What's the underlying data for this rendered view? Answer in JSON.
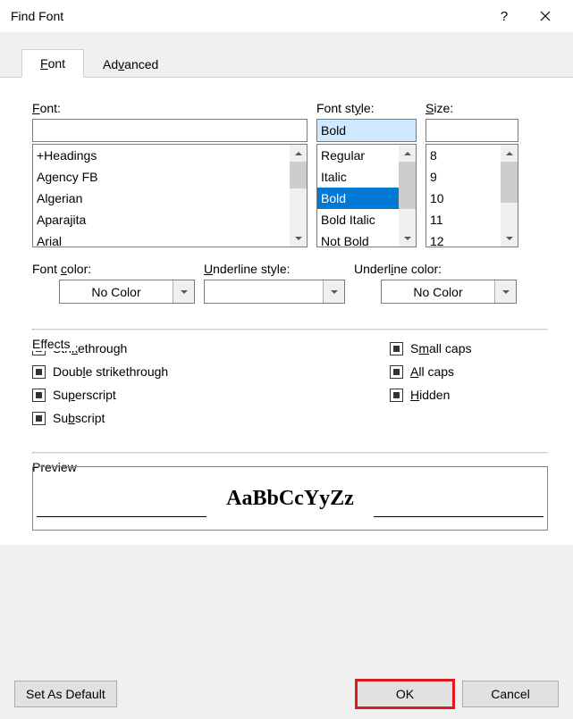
{
  "title": "Find Font",
  "tabs": {
    "font": "Font",
    "advanced": "Advanced"
  },
  "labels": {
    "font": "Font:",
    "fontStyle": "Font style:",
    "size": "Size:",
    "fontColor": "Font color:",
    "underlineStyle": "Underline style:",
    "underlineColor": "Underline color:",
    "effects": "Effects",
    "preview": "Preview"
  },
  "fontInput": "",
  "styleInput": "Bold",
  "sizeInput": "",
  "fontList": [
    "+Headings",
    "Agency FB",
    "Algerian",
    "Aparajita",
    "Arial"
  ],
  "styleList": [
    "Regular",
    "Italic",
    "Bold",
    "Bold Italic",
    "Not Bold"
  ],
  "styleSelectedIndex": 2,
  "sizeList": [
    "8",
    "9",
    "10",
    "11",
    "12"
  ],
  "fontColor": "No Color",
  "underlineStyle": "",
  "underlineColor": "No Color",
  "effects": {
    "strikethrough": "Strikethrough",
    "doubleStrikethrough": "Double strikethrough",
    "superscript": "Superscript",
    "subscript": "Subscript",
    "smallCaps": "Small caps",
    "allCaps": "All caps",
    "hidden": "Hidden"
  },
  "previewText": "AaBbCcYyZz",
  "buttons": {
    "setDefault": "Set As Default",
    "ok": "OK",
    "cancel": "Cancel"
  }
}
